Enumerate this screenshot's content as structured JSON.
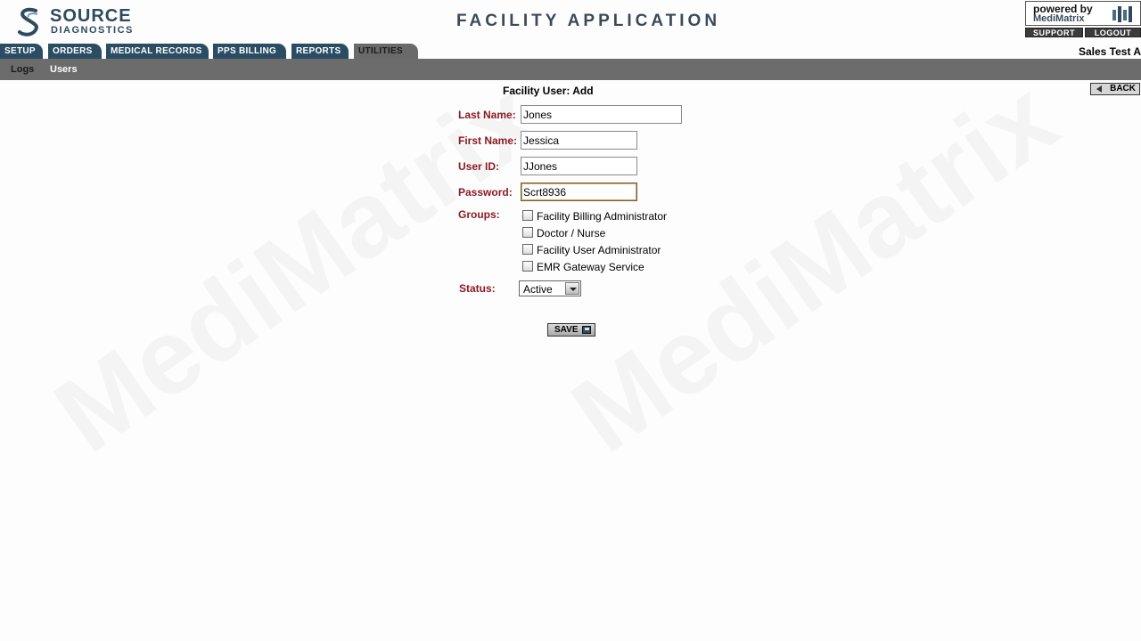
{
  "watermark": "MediMatrix",
  "header": {
    "logo_line1": "SOURCE",
    "logo_line2": "DIAGNOSTICS",
    "app_title": "FACILITY APPLICATION",
    "powered_by_line1": "powered by",
    "powered_by_line2": "MediMatrix",
    "support_label": "SUPPORT",
    "logout_label": "LOGOUT",
    "account_name": "Sales Test A"
  },
  "tabs": [
    {
      "label": "SETUP"
    },
    {
      "label": "ORDERS"
    },
    {
      "label": "MEDICAL RECORDS"
    },
    {
      "label": "PPS BILLING"
    },
    {
      "label": "REPORTS"
    },
    {
      "label": "UTILITIES",
      "active": true
    }
  ],
  "subnav": {
    "logs": "Logs",
    "users": "Users"
  },
  "form": {
    "title": "Facility User: Add",
    "back_label": "BACK",
    "last_name_label": "Last Name:",
    "last_name_value": "Jones",
    "first_name_label": "First Name:",
    "first_name_value": "Jessica",
    "user_id_label": "User ID:",
    "user_id_value": "JJones",
    "password_label": "Password:",
    "password_value": "Scrt8936",
    "groups_label": "Groups:",
    "groups": [
      {
        "label": "Facility Billing Administrator",
        "checked": false
      },
      {
        "label": "Doctor / Nurse",
        "checked": false
      },
      {
        "label": "Facility User Administrator",
        "checked": false
      },
      {
        "label": "EMR Gateway Service",
        "checked": false
      }
    ],
    "status_label": "Status:",
    "status_value": "Active",
    "save_label": "SAVE"
  },
  "colors": {
    "tab_bg": "#2a4d63",
    "subnav_bg": "#6c6c6c",
    "label_red": "#8a1c24"
  }
}
